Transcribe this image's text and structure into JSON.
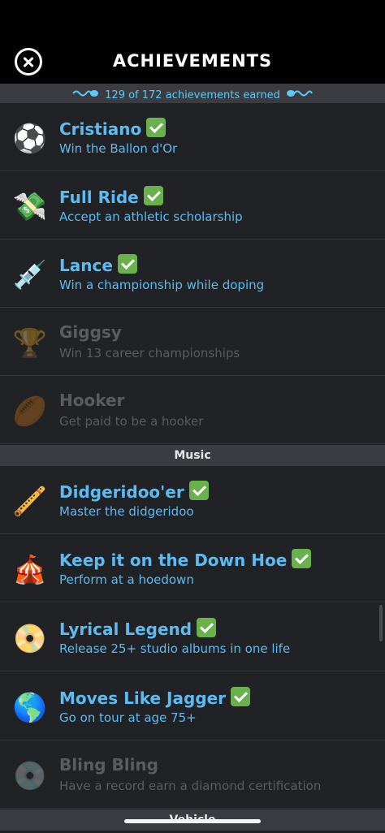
{
  "header": {
    "title": "ACHIEVEMENTS",
    "close_icon": "close-icon"
  },
  "progress": {
    "text": "129 of 172 achievements earned",
    "earned": 129,
    "total": 172,
    "accent": "#5fc8f2"
  },
  "rows": [
    {
      "icon": "⚽",
      "icon_name": "soccer-ball-icon",
      "name": "Cristiano",
      "desc": "Win the Ballon d'Or",
      "earned": true
    },
    {
      "icon": "💸",
      "icon_name": "money-with-wings-icon",
      "name": "Full Ride",
      "desc": "Accept an athletic scholarship",
      "earned": true
    },
    {
      "icon": "💉",
      "icon_name": "syringe-icon",
      "name": "Lance",
      "desc": "Win a championship while doping",
      "earned": true
    },
    {
      "icon": "🏆",
      "icon_name": "trophy-icon",
      "name": "Giggsy",
      "desc": "Win 13 career championships",
      "earned": false
    },
    {
      "icon": "🏉",
      "icon_name": "rugby-ball-icon",
      "name": "Hooker",
      "desc": "Get paid to be a hooker",
      "earned": false
    }
  ],
  "section_music": "Music",
  "music_rows": [
    {
      "icon": "🪈",
      "icon_name": "didgeridoo-icon",
      "name": "Didgeridoo'er",
      "desc": "Master the didgeridoo",
      "earned": true
    },
    {
      "icon": "🎪",
      "icon_name": "circus-tent-icon",
      "name": "Keep it on the Down Hoe",
      "desc": "Perform at a hoedown",
      "earned": true
    },
    {
      "icon": "📀",
      "icon_name": "dvd-disc-icon",
      "name": "Lyrical Legend",
      "desc": "Release 25+ studio albums in one life",
      "earned": true
    },
    {
      "icon": "🌎",
      "icon_name": "globe-americas-icon",
      "name": "Moves Like Jagger",
      "desc": "Go on tour at age 75+",
      "earned": true
    },
    {
      "icon": "💿",
      "icon_name": "diamond-record-icon",
      "name": "Bling Bling",
      "desc": "Have a record earn a diamond certification",
      "earned": false
    }
  ],
  "section_next": "Vehicle"
}
